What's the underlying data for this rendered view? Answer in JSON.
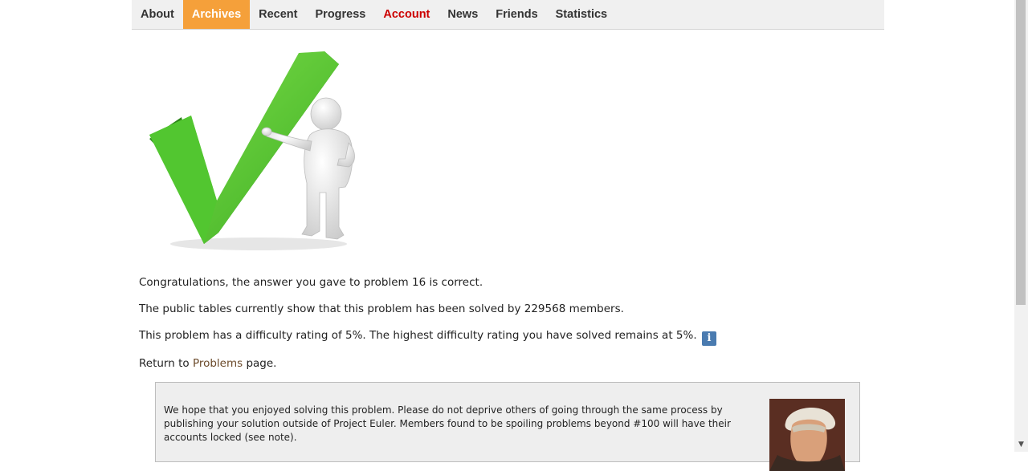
{
  "nav": {
    "items": [
      {
        "label": "About"
      },
      {
        "label": "Archives"
      },
      {
        "label": "Recent"
      },
      {
        "label": "Progress"
      },
      {
        "label": "Account"
      },
      {
        "label": "News"
      },
      {
        "label": "Friends"
      },
      {
        "label": "Statistics"
      }
    ]
  },
  "result": {
    "congrats": "Congratulations, the answer you gave to problem 16 is correct.",
    "solved_by": "The public tables currently show that this problem has been solved by 229568 members.",
    "difficulty": "This problem has a difficulty rating of 5%. The highest difficulty rating you have solved remains at 5%.",
    "info_icon_glyph": "i",
    "return_prefix": "Return to ",
    "return_link": "Problems",
    "return_suffix": " page."
  },
  "notice": {
    "text": "We hope that you enjoyed solving this problem. Please do not deprive others of going through the same process by publishing your solution outside of Project Euler. Members found to be spoiling problems beyond #100 will have their accounts locked (see note)."
  },
  "colors": {
    "active_tab": "#f5a03a",
    "account_tab": "#cc0000",
    "check_green": "#4cb82e",
    "info_blue": "#4a7bb0"
  },
  "icons": {
    "hero": "green-checkmark-with-figure",
    "scroll_down": "chevron-down-icon"
  }
}
